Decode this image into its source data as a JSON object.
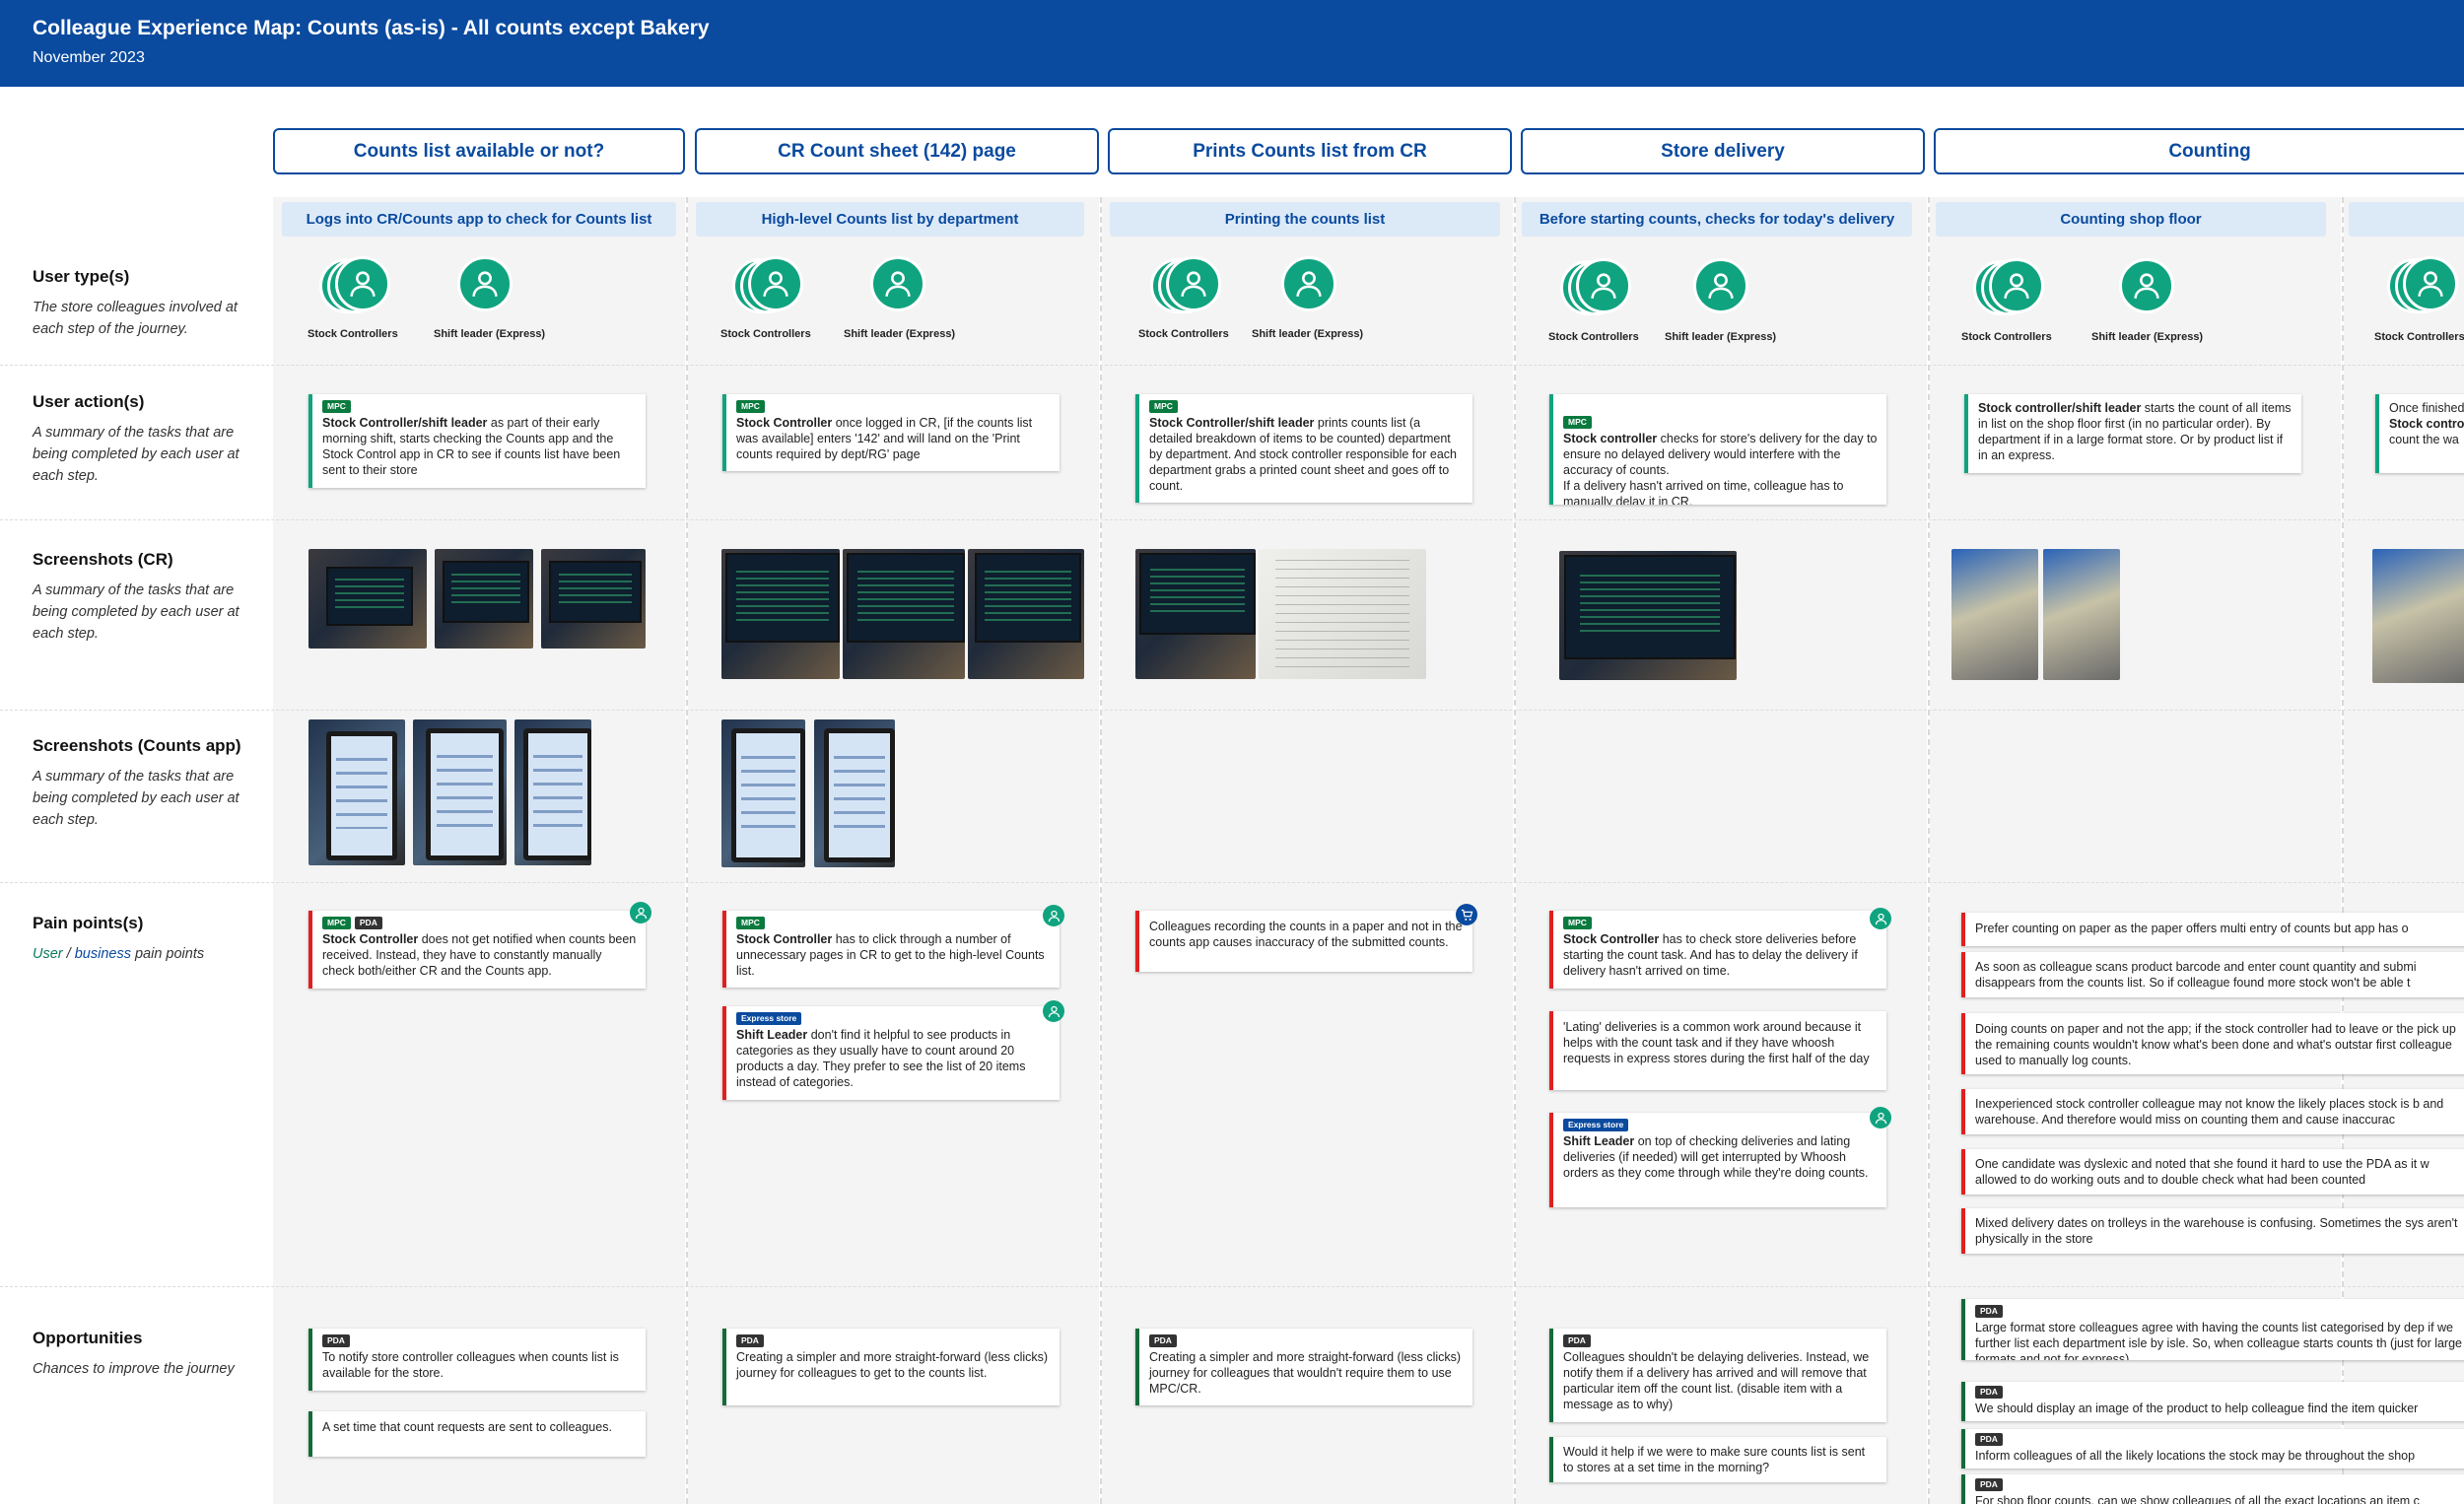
{
  "header": {
    "title": "Colleague Experience Map: Counts (as-is) - All counts except Bakery",
    "subtitle": "November 2023"
  },
  "colors": {
    "header_bg": "#0a4a9f",
    "accent_green": "#10a37f",
    "pain_red": "#e02020",
    "opportunity_green": "#146b3a",
    "step_bg": "#dceaf7"
  },
  "stages": [
    "Counts list available or not?",
    "CR Count sheet (142) page",
    "Prints Counts list from CR",
    "Store delivery",
    "Counting"
  ],
  "steps": [
    "Logs into CR/Counts app to check for Counts list",
    "High-level Counts list by department",
    "Printing the counts list",
    "Before starting counts, checks for today's delivery",
    "Counting shop floor"
  ],
  "rows": {
    "user_types": {
      "title": "User type(s)",
      "desc": "The store colleagues involved at each step of the journey."
    },
    "user_actions": {
      "title": "User action(s)",
      "desc": "A summary of the tasks that are being completed by each user at each step."
    },
    "screenshots_cr": {
      "title": "Screenshots (CR)",
      "desc": "A summary of the tasks that are being completed by each user at each step."
    },
    "screenshots_app": {
      "title": "Screenshots (Counts app)",
      "desc": "A summary of the tasks that are being completed by each user at each step."
    },
    "pain_points": {
      "title": "Pain points(s)",
      "desc_user": "User",
      "desc_sep": " / ",
      "desc_business": "business",
      "desc_rest": " pain points"
    },
    "opportunities": {
      "title": "Opportunities",
      "desc": "Chances to improve the journey"
    }
  },
  "user_labels": {
    "stock": "Stock Controllers",
    "shift": "Shift leader (Express)"
  },
  "tags": {
    "mpc": "MPC",
    "pda": "PDA",
    "express": "Express store"
  },
  "icons": {
    "user": "user-icon",
    "business": "cart-icon"
  },
  "actions": [
    {
      "bold": "Stock Controller/shift leader",
      "text": " as part of their early morning shift, starts checking the Counts app and the Stock Control app in CR to see if counts list have been sent to their store"
    },
    {
      "bold": "Stock Controller",
      "text": " once logged in CR, [if the counts list was available] enters '142' and will land on the 'Print counts required by dept/RG' page"
    },
    {
      "bold": "Stock Controller/shift leader",
      "text": " prints counts list (a detailed breakdown of items to be counted) department by department. And stock controller responsible for each department grabs a printed count sheet and goes off to count."
    },
    {
      "bold": "Stock controller",
      "text": " checks for store's delivery for the day to ensure no delayed delivery would interfere with the accuracy of counts.\nIf a delivery hasn't arrived on time, colleague has to manually delay it in CR."
    },
    {
      "bold": "Stock controller/shift leader",
      "text": " starts the count of all items in list on the shop floor first (in no particular order). By department if in a large format store. Or by product list if in an express."
    },
    {
      "text1": "Once finished",
      "bold": "Stock contro",
      "text2": "count the wa"
    }
  ],
  "pains": {
    "c1": [
      {
        "bold": "Stock Controller",
        "text": " does not get notified when counts been received. Instead, they have to constantly manually check both/either CR and the Counts app."
      }
    ],
    "c2": [
      {
        "bold": "Stock Controller",
        "text": " has to click through a number of unnecessary pages in CR to get to the high-level Counts list."
      },
      {
        "bold": "Shift Leader",
        "text": " don't find it helpful to see products in categories as they usually have to count around 20 products a day. They prefer to see the list of 20 items instead of categories."
      }
    ],
    "c3": [
      {
        "text": "Colleagues recording the counts in a paper and not in the counts app causes inaccuracy of the submitted counts."
      }
    ],
    "c4": [
      {
        "bold": "Stock Controller",
        "text": " has to check store deliveries before starting the count task. And has to delay the delivery if delivery hasn't arrived on time."
      },
      {
        "text": "'Lating' deliveries is a common work around because it helps with the count task and if they have whoosh requests in express stores during the first half of the day"
      },
      {
        "bold": "Shift Leader",
        "text": " on top of checking deliveries and lating deliveries (if needed) will get interrupted by Whoosh orders as they come through while they're doing counts."
      }
    ],
    "c5": [
      {
        "text": "Prefer counting on paper as the paper offers multi entry of counts but app has o"
      },
      {
        "text": "As soon as colleague scans product barcode and enter count quantity and submi disappears from the counts list. So if colleague found more stock won't be able t"
      },
      {
        "text": "Doing counts on paper and not the app; if the stock controller had to leave or the pick up the remaining counts wouldn't know what's been done and what's outstar first colleague used to manually log counts."
      },
      {
        "text": "Inexperienced stock controller colleague may not know the likely places stock is b and warehouse. And therefore would miss on counting them and cause inaccurac"
      },
      {
        "text": "One candidate was dyslexic and noted that she found it hard to use the PDA as it w allowed to do working outs and to double check what had been counted"
      },
      {
        "text": "Mixed delivery dates on trolleys in the warehouse is confusing. Sometimes the sys aren't physically in the store"
      }
    ]
  },
  "opportunities": {
    "c1": [
      {
        "text": "To notify store controller colleagues when counts list is available for the store."
      },
      {
        "text": "A set time that count requests are sent to colleagues."
      }
    ],
    "c2": [
      {
        "text": "Creating a simpler and more straight-forward (less clicks) journey for colleagues to get to the counts list."
      }
    ],
    "c3": [
      {
        "text": "Creating a simpler and more straight-forward (less clicks) journey for colleagues that wouldn't require them to use MPC/CR."
      }
    ],
    "c4": [
      {
        "text": "Colleagues shouldn't be delaying deliveries. Instead, we notify them if a delivery has arrived and will remove that particular item off the count list. (disable item with a message as to why)"
      },
      {
        "text": "Would it help if we were to make sure counts list is sent to stores at a set time in the morning?"
      }
    ],
    "c5": [
      {
        "text": "Large format store colleagues agree with having the counts list categorised by dep if we further list each department isle by isle. So, when colleague starts counts th (just for large formats and not for express)"
      },
      {
        "text": "We should display an image of the product to help colleague find the item quicker"
      },
      {
        "text": "Inform colleagues of all the likely locations the stock may be throughout the shop"
      },
      {
        "text": "For shop floor counts, can we show colleagues of all the exact locations an item c"
      }
    ]
  }
}
